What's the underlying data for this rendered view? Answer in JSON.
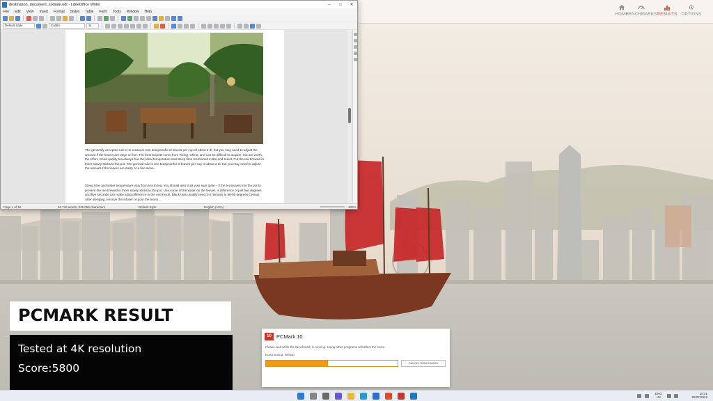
{
  "pcmark_nav": {
    "items": [
      {
        "label": "HOME",
        "icon": "home-icon"
      },
      {
        "label": "BENCHMARKS",
        "icon": "gauge-icon"
      },
      {
        "label": "RESULTS",
        "icon": "bar-chart-icon",
        "active": true
      },
      {
        "label": "OPTIONS",
        "icon": "gear-icon"
      }
    ]
  },
  "writer": {
    "title": "destination_document_sodiate.odt - LibreOffice Writer",
    "menu": [
      "File",
      "Edit",
      "View",
      "Insert",
      "Format",
      "Styles",
      "Table",
      "Form",
      "Tools",
      "Window",
      "Help"
    ],
    "paragraph_style": "Default Style",
    "font_name": "Calibri",
    "font_size": "11",
    "body_para1": "The generally accepted rule is to measure one teaspoonful of leaves per cup of about 2 dl, but you may need to adjust the amount if the leaves are large or fine. The best teapots come from Yixing, China, and can be difficult to acquire, but are worth the effort. Good quality tea always has the ideal temperature and steep time mentioned in the end result. Put the tea brewed in them slowly sticks to the pot. The general rule is one teaspoonful of leaves per cup of about 2 dl, but you may need to adjust the amount if the leaves are dusty or a fine sieve.",
    "body_para2": "Steep time and water temperature vary from tea to tea. You should also trust your own taste – if the tea leaves into the pot to prevent the tea brewed in them slowly sticks to the pot. Use some of the water on the leaves. A difference of just five degrees and five seconds can make a big difference in the end result. Black teas usually need 3-4 minutes in 90-95 degrees Celsius. After steeping, remove the infuser or pour the tea to...",
    "status": {
      "page": "Page 1 of 52",
      "words": "52 716 words, 335 059 characters",
      "style": "Default Style",
      "language": "English (USA)",
      "zoom": "100%"
    }
  },
  "overlay": {
    "heading": "PCMARK RESULT",
    "line1": "Tested at 4K resolution",
    "line2": "Score:5800"
  },
  "pcmark_dialog": {
    "logo": "10",
    "title": "PCMark 10",
    "message": "Please wait while the benchmark is running. Using other programs will affect the score.",
    "now_running": "Now running: Writing",
    "progress": 0.47,
    "cancel_label": "CANCEL BENCHMARK"
  },
  "taskbar": {
    "lang_line1": "ENG",
    "lang_line2": "UK",
    "time": "10:21",
    "date": "26/07/2022"
  },
  "colors": {
    "accent": "#d0523a",
    "progress": "#f19a12",
    "sail_red": "#c8282a"
  }
}
